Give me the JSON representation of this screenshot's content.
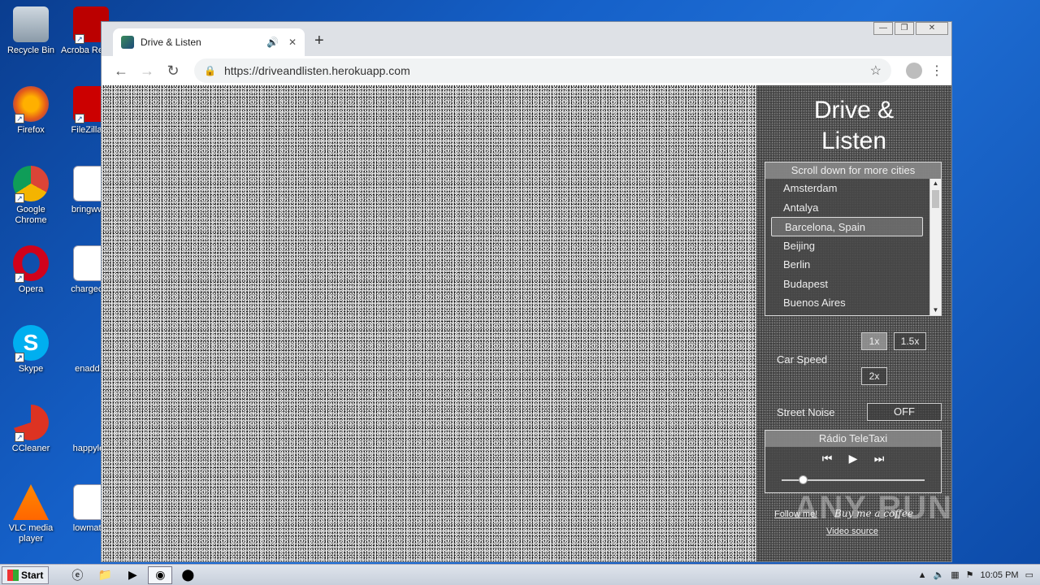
{
  "desktop": {
    "icons": [
      {
        "label": "Recycle Bin",
        "icon": "recycle-bin-icon"
      },
      {
        "label": "Acroba Reader",
        "icon": "acrobat-icon"
      },
      {
        "label": "Firefox",
        "icon": "firefox-icon"
      },
      {
        "label": "FileZilla C",
        "icon": "filezilla-icon"
      },
      {
        "label": "Google Chrome",
        "icon": "chrome-icon"
      },
      {
        "label": "bringwww",
        "icon": "word-doc-icon"
      },
      {
        "label": "Opera",
        "icon": "opera-icon"
      },
      {
        "label": "chargecivi",
        "icon": "word-doc-icon"
      },
      {
        "label": "Skype",
        "icon": "skype-icon"
      },
      {
        "label": "enadd.p",
        "icon": "file-icon"
      },
      {
        "label": "CCleaner",
        "icon": "ccleaner-icon"
      },
      {
        "label": "happylea",
        "icon": "file-icon"
      },
      {
        "label": "VLC media player",
        "icon": "vlc-icon"
      },
      {
        "label": "lowmatur",
        "icon": "word-doc-icon"
      }
    ]
  },
  "browser": {
    "tab_title": "Drive & Listen",
    "new_tab_symbol": "+",
    "url": "https://driveandlisten.herokuapp.com",
    "window_controls": {
      "minimize": "—",
      "restore": "❐",
      "close": "✕"
    }
  },
  "app": {
    "logo_line1": "Drive &",
    "logo_line2": "Listen",
    "city_header": "Scroll down for more cities",
    "cities": [
      "Amsterdam",
      "Antalya",
      "Barcelona, Spain",
      "Beijing",
      "Berlin",
      "Budapest",
      "Buenos Aires"
    ],
    "selected_city": "Barcelona, Spain",
    "car_speed_label": "Car Speed",
    "speed_options": [
      "1x",
      "1.5x",
      "2x"
    ],
    "selected_speed": "1x",
    "street_noise_label": "Street Noise",
    "street_noise_value": "OFF",
    "radio_title": "Rádio TeleTaxi",
    "radio_volume": 0.15,
    "follow_link": "Follow me!",
    "coffee_link": "Buy me a coffee",
    "video_source_link": "Video source"
  },
  "watermark": "ANY RUN",
  "taskbar": {
    "start_label": "Start",
    "clock": "10:05 PM"
  }
}
